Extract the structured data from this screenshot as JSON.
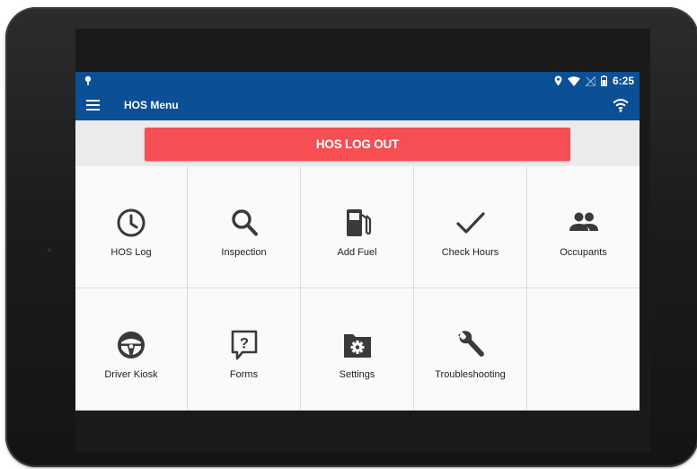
{
  "statusbar": {
    "time": "6:25"
  },
  "appbar": {
    "title": "HOS Menu"
  },
  "logout": {
    "label": "HOS LOG OUT"
  },
  "tiles": [
    {
      "label": "HOS Log",
      "icon": "clock-icon"
    },
    {
      "label": "Inspection",
      "icon": "search-icon"
    },
    {
      "label": "Add Fuel",
      "icon": "fuel-pump-icon"
    },
    {
      "label": "Check Hours",
      "icon": "checkmark-icon"
    },
    {
      "label": "Occupants",
      "icon": "people-icon"
    },
    {
      "label": "Driver Kiosk",
      "icon": "steering-wheel-icon"
    },
    {
      "label": "Forms",
      "icon": "question-bubble-icon"
    },
    {
      "label": "Settings",
      "icon": "gear-folder-icon"
    },
    {
      "label": "Troubleshooting",
      "icon": "wrench-icon"
    }
  ],
  "colors": {
    "appbar": "#0b4f94",
    "logout_button": "#f54f54",
    "background": "#fafafa"
  }
}
